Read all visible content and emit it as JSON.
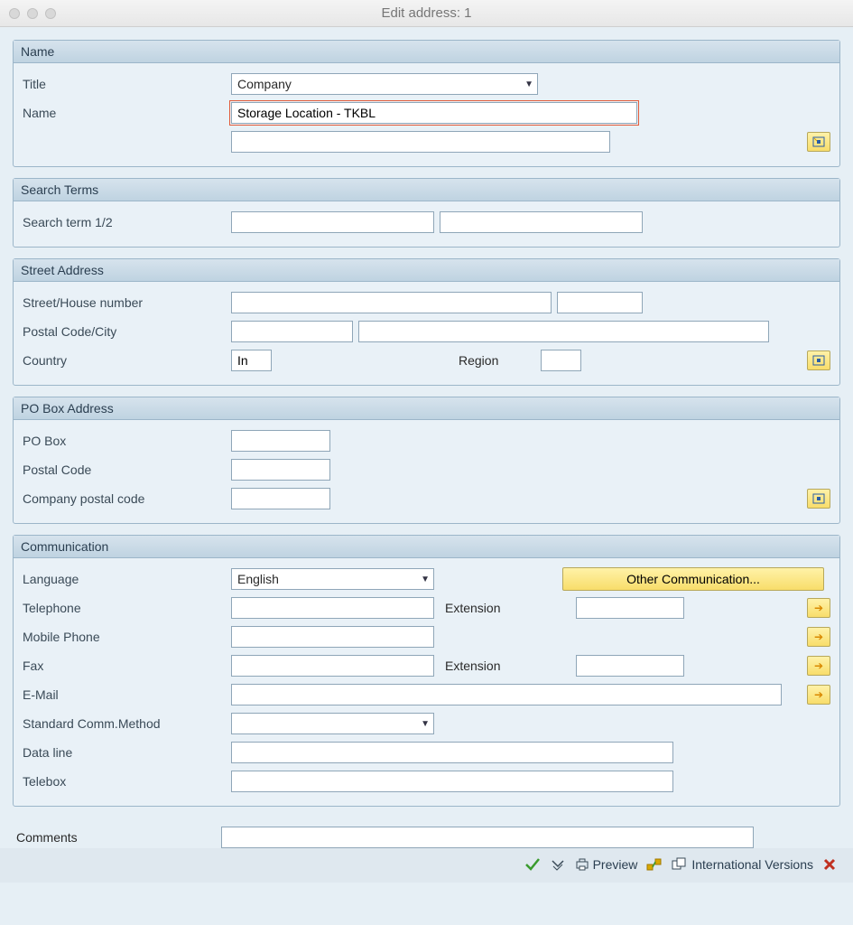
{
  "window": {
    "title": "Edit address:  1"
  },
  "name_group": {
    "head": "Name",
    "title_label": "Title",
    "title_value": "Company",
    "name_label": "Name",
    "name_value": "Storage Location - TKBL",
    "name2_value": ""
  },
  "search_group": {
    "head": "Search Terms",
    "search_label": "Search term 1/2",
    "s1": "",
    "s2": ""
  },
  "street_group": {
    "head": "Street Address",
    "street_label": "Street/House number",
    "street": "",
    "houseno": "",
    "postal_label": "Postal Code/City",
    "postal": "",
    "city": "",
    "country_label": "Country",
    "country": "In",
    "region_label": "Region",
    "region": ""
  },
  "pobox_group": {
    "head": "PO Box Address",
    "pobox_label": "PO Box",
    "pobox": "",
    "postal_label": "Postal Code",
    "postal": "",
    "company_label": "Company postal code",
    "company": ""
  },
  "comm_group": {
    "head": "Communication",
    "language_label": "Language",
    "language_value": "English",
    "other_btn": "Other Communication...",
    "tel_label": "Telephone",
    "tel": "",
    "tel_ext_label": "Extension",
    "tel_ext": "",
    "mobile_label": "Mobile Phone",
    "mobile": "",
    "fax_label": "Fax",
    "fax": "",
    "fax_ext_label": "Extension",
    "fax_ext": "",
    "email_label": "E-Mail",
    "email": "",
    "std_label": "Standard Comm.Method",
    "std_value": "",
    "dataline_label": "Data line",
    "dataline": "",
    "telebox_label": "Telebox",
    "telebox": ""
  },
  "comments": {
    "label": "Comments",
    "value": ""
  },
  "toolbar": {
    "preview": "Preview",
    "intl": "International Versions"
  }
}
